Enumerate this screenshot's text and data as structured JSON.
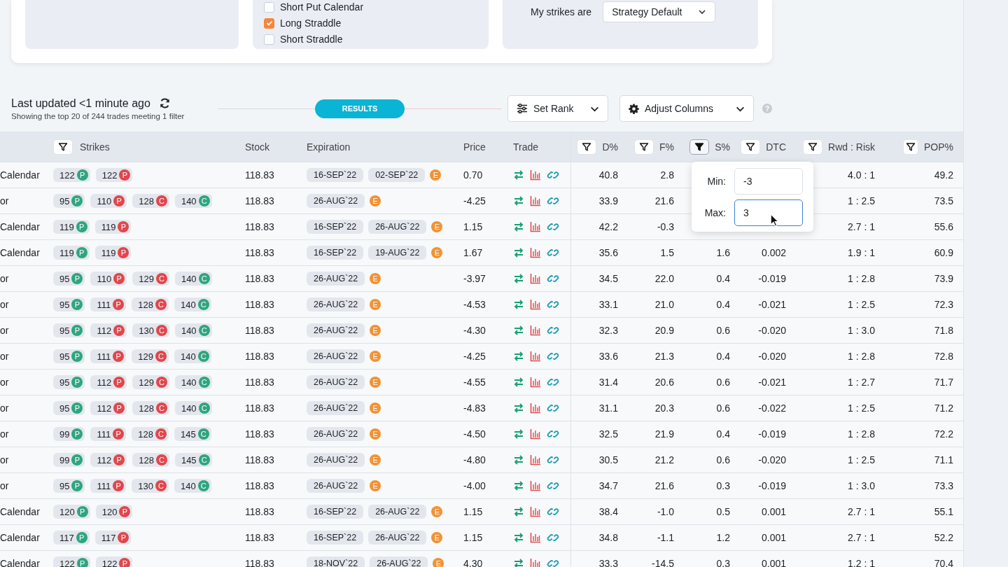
{
  "filters_card": {
    "panels": [
      {
        "kind": "empty"
      },
      {
        "kind": "checklist",
        "items": [
          {
            "label": "Short Put Calendar",
            "checked": false
          },
          {
            "label": "Long Straddle",
            "checked": true
          },
          {
            "label": "Short Straddle",
            "checked": false
          }
        ]
      },
      {
        "kind": "select",
        "label": "My strikes are",
        "value": "Strategy Default"
      }
    ]
  },
  "toolbar": {
    "title": "Last updated <1 minute ago",
    "subtitle": "Showing the top 20 of 244 trades meeting 1 filter",
    "results_label": "RESULTS",
    "buttons": [
      {
        "label": "Set Rank",
        "kind": "rank"
      },
      {
        "label": "Adjust Columns",
        "kind": "columns"
      }
    ],
    "help": "?"
  },
  "table": {
    "columns": [
      {
        "label": "Strikes",
        "kind": "filter",
        "active": false
      },
      {
        "label": "Stock",
        "kind": "plain"
      },
      {
        "label": "Expiration",
        "kind": "plain"
      },
      {
        "label": "Price",
        "kind": "plain"
      },
      {
        "label": "Trade",
        "kind": "plain"
      },
      {
        "label": "D%",
        "kind": "filter",
        "active": false
      },
      {
        "label": "F%",
        "kind": "filter",
        "active": false
      },
      {
        "label": "S%",
        "kind": "filter",
        "active": true
      },
      {
        "label": "DTC",
        "kind": "filter",
        "active": false
      },
      {
        "label": "Rwd : Risk",
        "kind": "filter",
        "active": false
      },
      {
        "label": "POP%",
        "kind": "filter",
        "active": false
      }
    ],
    "rows": [
      {
        "strategy": "Calendar",
        "strikes": [
          {
            "value": "122",
            "letter": "P",
            "color": "#2fa57f"
          },
          {
            "value": "122",
            "letter": "P",
            "color": "#e0474c"
          }
        ],
        "stock": "118.83",
        "expirations": [
          "16-SEP`22",
          "02-SEP`22"
        ],
        "earnings": "E",
        "price": "0.70",
        "d": "40.8",
        "f": "2.8",
        "rwd": "4.0 : 1",
        "pop": "49.2"
      },
      {
        "strategy": "or",
        "strikes": [
          {
            "value": "95",
            "letter": "P",
            "color": "#2fa57f"
          },
          {
            "value": "110",
            "letter": "P",
            "color": "#e0474c"
          },
          {
            "value": "128",
            "letter": "C",
            "color": "#e0474c"
          },
          {
            "value": "140",
            "letter": "C",
            "color": "#2fa57f"
          }
        ],
        "stock": "118.83",
        "expirations": [
          "26-AUG`22"
        ],
        "earnings": "E",
        "price": "-4.25",
        "d": "33.9",
        "f": "21.6",
        "rwd": "1 : 2.5",
        "pop": "73.5"
      },
      {
        "strategy": "Calendar",
        "strikes": [
          {
            "value": "119",
            "letter": "P",
            "color": "#2fa57f"
          },
          {
            "value": "119",
            "letter": "P",
            "color": "#e0474c"
          }
        ],
        "stock": "118.83",
        "expirations": [
          "16-SEP`22",
          "26-AUG`22"
        ],
        "earnings": "E",
        "price": "1.15",
        "d": "42.2",
        "f": "-0.3",
        "rwd": "2.7 : 1",
        "pop": "55.6"
      },
      {
        "strategy": "Calendar",
        "strikes": [
          {
            "value": "119",
            "letter": "P",
            "color": "#2fa57f"
          },
          {
            "value": "119",
            "letter": "P",
            "color": "#e0474c"
          }
        ],
        "stock": "118.83",
        "expirations": [
          "16-SEP`22",
          "19-AUG`22"
        ],
        "earnings": "E",
        "price": "1.67",
        "d": "35.6",
        "f": "1.5",
        "s": "1.6",
        "dtc": "0.002",
        "rwd": "1.9 : 1",
        "pop": "60.9"
      },
      {
        "strategy": "or",
        "strikes": [
          {
            "value": "95",
            "letter": "P",
            "color": "#2fa57f"
          },
          {
            "value": "110",
            "letter": "P",
            "color": "#e0474c"
          },
          {
            "value": "129",
            "letter": "C",
            "color": "#e0474c"
          },
          {
            "value": "140",
            "letter": "C",
            "color": "#2fa57f"
          }
        ],
        "stock": "118.83",
        "expirations": [
          "26-AUG`22"
        ],
        "earnings": "E",
        "price": "-3.97",
        "d": "34.5",
        "f": "22.0",
        "s": "0.4",
        "dtc": "-0.019",
        "rwd": "1 : 2.8",
        "pop": "73.9"
      },
      {
        "strategy": "or",
        "strikes": [
          {
            "value": "95",
            "letter": "P",
            "color": "#2fa57f"
          },
          {
            "value": "111",
            "letter": "P",
            "color": "#e0474c"
          },
          {
            "value": "128",
            "letter": "C",
            "color": "#e0474c"
          },
          {
            "value": "140",
            "letter": "C",
            "color": "#2fa57f"
          }
        ],
        "stock": "118.83",
        "expirations": [
          "26-AUG`22"
        ],
        "earnings": "E",
        "price": "-4.53",
        "d": "33.1",
        "f": "21.0",
        "s": "0.4",
        "dtc": "-0.021",
        "rwd": "1 : 2.5",
        "pop": "72.3"
      },
      {
        "strategy": "or",
        "strikes": [
          {
            "value": "95",
            "letter": "P",
            "color": "#2fa57f"
          },
          {
            "value": "112",
            "letter": "P",
            "color": "#e0474c"
          },
          {
            "value": "130",
            "letter": "C",
            "color": "#e0474c"
          },
          {
            "value": "140",
            "letter": "C",
            "color": "#2fa57f"
          }
        ],
        "stock": "118.83",
        "expirations": [
          "26-AUG`22"
        ],
        "earnings": "E",
        "price": "-4.30",
        "d": "32.3",
        "f": "20.9",
        "s": "0.6",
        "dtc": "-0.020",
        "rwd": "1 : 3.0",
        "pop": "71.8"
      },
      {
        "strategy": "or",
        "strikes": [
          {
            "value": "95",
            "letter": "P",
            "color": "#2fa57f"
          },
          {
            "value": "111",
            "letter": "P",
            "color": "#e0474c"
          },
          {
            "value": "129",
            "letter": "C",
            "color": "#e0474c"
          },
          {
            "value": "140",
            "letter": "C",
            "color": "#2fa57f"
          }
        ],
        "stock": "118.83",
        "expirations": [
          "26-AUG`22"
        ],
        "earnings": "E",
        "price": "-4.25",
        "d": "33.6",
        "f": "21.3",
        "s": "0.4",
        "dtc": "-0.020",
        "rwd": "1 : 2.8",
        "pop": "72.8"
      },
      {
        "strategy": "or",
        "strikes": [
          {
            "value": "95",
            "letter": "P",
            "color": "#2fa57f"
          },
          {
            "value": "112",
            "letter": "P",
            "color": "#e0474c"
          },
          {
            "value": "129",
            "letter": "C",
            "color": "#e0474c"
          },
          {
            "value": "140",
            "letter": "C",
            "color": "#2fa57f"
          }
        ],
        "stock": "118.83",
        "expirations": [
          "26-AUG`22"
        ],
        "earnings": "E",
        "price": "-4.55",
        "d": "31.4",
        "f": "20.6",
        "s": "0.6",
        "dtc": "-0.021",
        "rwd": "1 : 2.7",
        "pop": "71.7"
      },
      {
        "strategy": "or",
        "strikes": [
          {
            "value": "95",
            "letter": "P",
            "color": "#2fa57f"
          },
          {
            "value": "112",
            "letter": "P",
            "color": "#e0474c"
          },
          {
            "value": "128",
            "letter": "C",
            "color": "#e0474c"
          },
          {
            "value": "140",
            "letter": "C",
            "color": "#2fa57f"
          }
        ],
        "stock": "118.83",
        "expirations": [
          "26-AUG`22"
        ],
        "earnings": "E",
        "price": "-4.83",
        "d": "31.1",
        "f": "20.3",
        "s": "0.6",
        "dtc": "-0.022",
        "rwd": "1 : 2.5",
        "pop": "71.2"
      },
      {
        "strategy": "or",
        "strikes": [
          {
            "value": "99",
            "letter": "P",
            "color": "#2fa57f"
          },
          {
            "value": "111",
            "letter": "P",
            "color": "#e0474c"
          },
          {
            "value": "128",
            "letter": "C",
            "color": "#e0474c"
          },
          {
            "value": "145",
            "letter": "C",
            "color": "#2fa57f"
          }
        ],
        "stock": "118.83",
        "expirations": [
          "26-AUG`22"
        ],
        "earnings": "E",
        "price": "-4.50",
        "d": "32.5",
        "f": "21.9",
        "s": "0.4",
        "dtc": "-0.019",
        "rwd": "1 : 2.8",
        "pop": "72.2"
      },
      {
        "strategy": "or",
        "strikes": [
          {
            "value": "99",
            "letter": "P",
            "color": "#2fa57f"
          },
          {
            "value": "112",
            "letter": "P",
            "color": "#e0474c"
          },
          {
            "value": "128",
            "letter": "C",
            "color": "#e0474c"
          },
          {
            "value": "145",
            "letter": "C",
            "color": "#2fa57f"
          }
        ],
        "stock": "118.83",
        "expirations": [
          "26-AUG`22"
        ],
        "earnings": "E",
        "price": "-4.80",
        "d": "30.5",
        "f": "21.2",
        "s": "0.6",
        "dtc": "-0.020",
        "rwd": "1 : 2.5",
        "pop": "71.1"
      },
      {
        "strategy": "or",
        "strikes": [
          {
            "value": "95",
            "letter": "P",
            "color": "#2fa57f"
          },
          {
            "value": "111",
            "letter": "P",
            "color": "#e0474c"
          },
          {
            "value": "130",
            "letter": "C",
            "color": "#e0474c"
          },
          {
            "value": "140",
            "letter": "C",
            "color": "#2fa57f"
          }
        ],
        "stock": "118.83",
        "expirations": [
          "26-AUG`22"
        ],
        "earnings": "E",
        "price": "-4.00",
        "d": "34.7",
        "f": "21.6",
        "s": "0.3",
        "dtc": "-0.019",
        "rwd": "1 : 3.0",
        "pop": "73.3"
      },
      {
        "strategy": "Calendar",
        "strikes": [
          {
            "value": "120",
            "letter": "P",
            "color": "#2fa57f"
          },
          {
            "value": "120",
            "letter": "P",
            "color": "#e0474c"
          }
        ],
        "stock": "118.83",
        "expirations": [
          "16-SEP`22",
          "26-AUG`22"
        ],
        "earnings": "E",
        "price": "1.15",
        "d": "38.4",
        "f": "-1.0",
        "s": "0.5",
        "dtc": "0.001",
        "rwd": "2.7 : 1",
        "pop": "55.1"
      },
      {
        "strategy": "Calendar",
        "strikes": [
          {
            "value": "117",
            "letter": "P",
            "color": "#2fa57f"
          },
          {
            "value": "117",
            "letter": "P",
            "color": "#e0474c"
          }
        ],
        "stock": "118.83",
        "expirations": [
          "16-SEP`22",
          "26-AUG`22"
        ],
        "earnings": "E",
        "price": "1.15",
        "d": "34.8",
        "f": "-1.1",
        "s": "1.2",
        "dtc": "0.001",
        "rwd": "2.7 : 1",
        "pop": "52.2"
      },
      {
        "strategy": "Calendar",
        "strikes": [
          {
            "value": "122",
            "letter": "P",
            "color": "#2fa57f"
          },
          {
            "value": "122",
            "letter": "P",
            "color": "#e0474c"
          }
        ],
        "stock": "118.83",
        "expirations": [
          "18-NOV`22",
          "26-AUG`22"
        ],
        "earnings": "E",
        "price": "4.30",
        "d": "33.3",
        "f": "-14.5",
        "s": "0.3",
        "dtc": "0.001",
        "rwd": "1.2 : 1",
        "pop": "70.4"
      }
    ],
    "filter_popover": {
      "fields": [
        {
          "label": "Min:",
          "value": "-3",
          "focused": false
        },
        {
          "label": "Max:",
          "value": "3",
          "focused": true
        }
      ]
    }
  }
}
